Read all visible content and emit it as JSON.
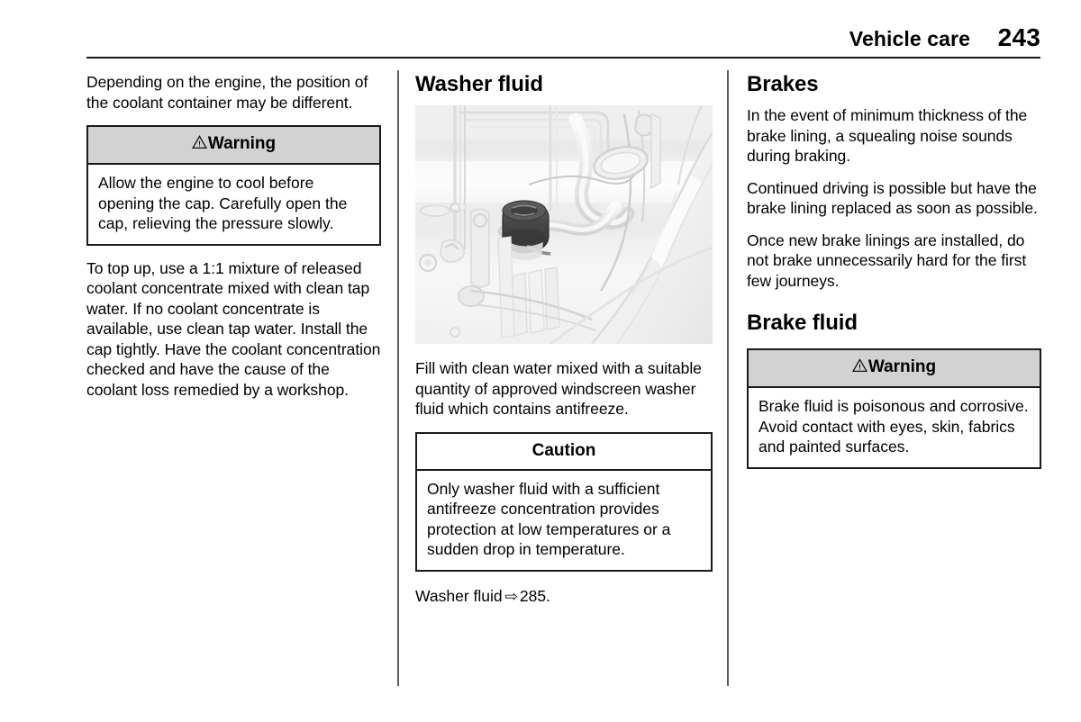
{
  "header": {
    "title": "Vehicle care",
    "page_number": "243"
  },
  "left_column": {
    "intro_paragraph": "Depending on the engine, the position of the coolant container may be different.",
    "warning": {
      "icon": "warning-triangle-icon",
      "label": "Warning",
      "text": "Allow the engine to cool before opening the cap. Carefully open the cap, relieving the pressure slowly."
    },
    "topup_paragraph": "To top up, use a 1:1 mixture of released coolant concentrate mixed with clean tap water. If no coolant concentrate is available, use clean tap water. Install the cap tightly. Have the coolant concentration checked and have the cause of the coolant loss remedied by a workshop."
  },
  "middle_column": {
    "heading": "Washer fluid",
    "figure": {
      "alt": "Engine bay showing washer fluid reservoir cap",
      "name": "washer-fluid-reservoir-photo"
    },
    "fill_paragraph": "Fill with clean water mixed with a suitable quantity of approved windscreen washer fluid which contains antifreeze.",
    "caution": {
      "label": "Caution",
      "text": "Only washer fluid with a sufficient antifreeze concentration provides protection at low temperatures or a sudden drop in temperature."
    },
    "cross_reference": {
      "label": "Washer fluid",
      "arrow": "⇨",
      "page": "285."
    }
  },
  "right_column": {
    "brakes_heading": "Brakes",
    "brakes_paragraph_1": "In the event of minimum thickness of the brake lining, a squealing noise sounds during braking.",
    "brakes_paragraph_2": "Continued driving is possible but have the brake lining replaced as soon as possible.",
    "brakes_paragraph_3": "Once new brake linings are installed, do not brake unnecessarily hard for the first few journeys.",
    "brake_fluid_heading": "Brake fluid",
    "warning": {
      "icon": "warning-triangle-icon",
      "label": "Warning",
      "text": "Brake fluid is poisonous and corrosive. Avoid contact with eyes, skin, fabrics and painted surfaces."
    }
  },
  "colors": {
    "text": "#000000",
    "rule": "#1a1a1a",
    "divider": "#5d5d5d",
    "warning_header_bg": "#d2d2d2",
    "figure_bg": "#fbfbfb"
  }
}
